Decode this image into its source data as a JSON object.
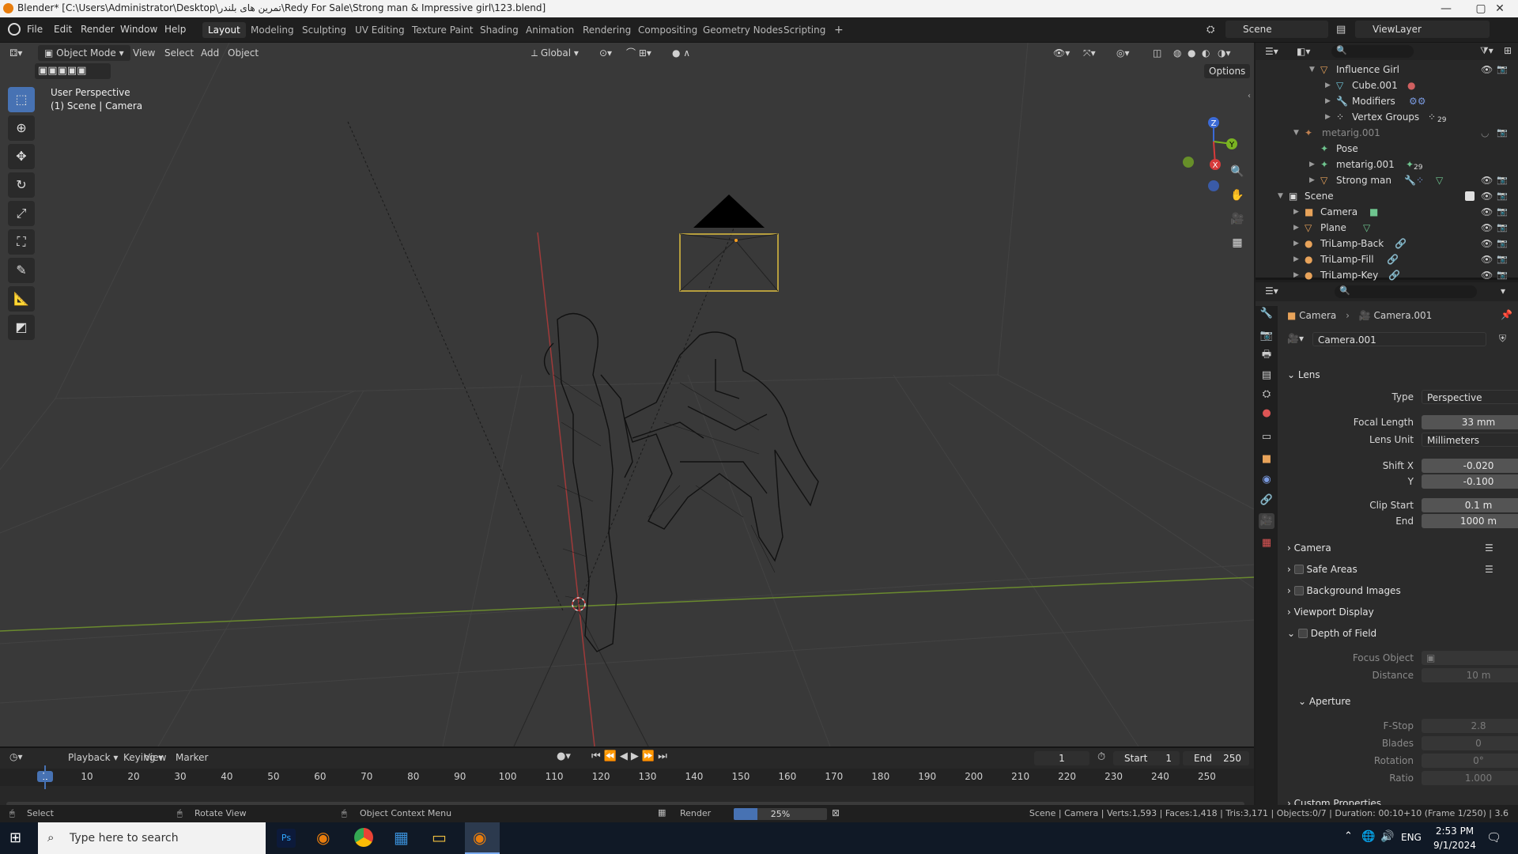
{
  "window": {
    "title": "Blender* [C:\\Users\\Administrator\\Desktop\\تمرین های بلندر\\Redy For Sale\\Strong man & Impressive girl\\123.blend]",
    "min": "—",
    "max": "▢",
    "close": "✕"
  },
  "menu": [
    "File",
    "Edit",
    "Render",
    "Window",
    "Help"
  ],
  "workspaces": [
    "Layout",
    "Modeling",
    "Sculpting",
    "UV Editing",
    "Texture Paint",
    "Shading",
    "Animation",
    "Rendering",
    "Compositing",
    "Geometry Nodes",
    "Scripting",
    "+"
  ],
  "scene_name": "Scene",
  "view_layer": "ViewLayer",
  "viewport": {
    "mode": "Object Mode",
    "menus": [
      "View",
      "Select",
      "Add",
      "Object"
    ],
    "transform_orientation": "Global",
    "options": "Options",
    "overlay_line1": "User Perspective",
    "overlay_line2": "(1) Scene | Camera",
    "axis_z": "Z",
    "axis_y": "Y",
    "axis_x": "X"
  },
  "outliner": {
    "rows": [
      {
        "label": "Influence Girl",
        "icon": "▽",
        "color": "#e8a35a"
      },
      {
        "label": "Cube.001",
        "icon": "▽",
        "color": "#6fc5d8"
      },
      {
        "label": "Modifiers",
        "icon": "🔧",
        "color": "#7a9ae0"
      },
      {
        "label": "Vertex Groups",
        "icon": "⁘",
        "color": "#cfcfcf"
      },
      {
        "label": "metarig.001",
        "icon": "✦",
        "color": "#e8a35a"
      },
      {
        "label": "Pose",
        "icon": "✦",
        "color": "#6fc58f"
      },
      {
        "label": "metarig.001",
        "icon": "✦",
        "color": "#6fc58f"
      },
      {
        "label": "Strong man",
        "icon": "▽",
        "color": "#e8a35a"
      },
      {
        "label": "Scene",
        "icon": "▣",
        "color": "#cfcfcf"
      },
      {
        "label": "Camera",
        "icon": "■",
        "color": "#e8a35a"
      },
      {
        "label": "Plane",
        "icon": "▽",
        "color": "#e8a35a"
      },
      {
        "label": "TriLamp-Back",
        "icon": "●",
        "color": "#e8a35a"
      },
      {
        "label": "TriLamp-Fill",
        "icon": "●",
        "color": "#e8a35a"
      },
      {
        "label": "TriLamp-Key",
        "icon": "●",
        "color": "#e8a35a"
      }
    ],
    "vertex_group_count": "29",
    "metarig_bone_count": "29"
  },
  "properties": {
    "breadcrumb_object": "Camera",
    "breadcrumb_data": "Camera.001",
    "datablock": "Camera.001",
    "lens_header": "Lens",
    "type_label": "Type",
    "type_value": "Perspective",
    "focal_label": "Focal Length",
    "focal_value": "33 mm",
    "lens_unit_label": "Lens Unit",
    "lens_unit_value": "Millimeters",
    "shiftx_label": "Shift X",
    "shiftx_value": "-0.020",
    "shifty_label": "Y",
    "shifty_value": "-0.100",
    "clip_start_label": "Clip Start",
    "clip_start_value": "0.1 m",
    "clip_end_label": "End",
    "clip_end_value": "1000 m",
    "sections": [
      "Camera",
      "Safe Areas",
      "Background Images",
      "Viewport Display",
      "Depth of Field"
    ],
    "focus_label": "Focus Object",
    "distance_label": "Distance",
    "distance_value": "10 m",
    "aperture": "Aperture",
    "fstop_label": "F-Stop",
    "fstop_value": "2.8",
    "blades_label": "Blades",
    "blades_value": "0",
    "rotation_label": "Rotation",
    "rotation_value": "0°",
    "ratio_label": "Ratio",
    "ratio_value": "1.000",
    "custom_props": "Custom Properties"
  },
  "timeline": {
    "menus": [
      "Playback",
      "Keying",
      "View",
      "Marker"
    ],
    "current_frame": "1",
    "start_label": "Start",
    "start_value": "1",
    "end_label": "End",
    "end_value": "250",
    "ruler": [
      "1",
      "10",
      "20",
      "30",
      "40",
      "50",
      "60",
      "70",
      "80",
      "90",
      "100",
      "110",
      "120",
      "130",
      "140",
      "150",
      "160",
      "170",
      "180",
      "190",
      "200",
      "210",
      "220",
      "230",
      "240",
      "250"
    ]
  },
  "status": {
    "select": "Select",
    "rotate": "Rotate View",
    "context": "Object Context Menu",
    "render": "Render",
    "render_progress": "25%",
    "render_fraction": 0.25,
    "stats": "Scene | Camera | Verts:1,593 | Faces:1,418 | Tris:3,171 | Objects:0/7 | Duration: 00:10+10 (Frame 1/250) | 3.6"
  },
  "taskbar": {
    "search_placeholder": "Type here to search",
    "lang": "ENG",
    "time": "2:53 PM",
    "date": "9/1/2024"
  }
}
